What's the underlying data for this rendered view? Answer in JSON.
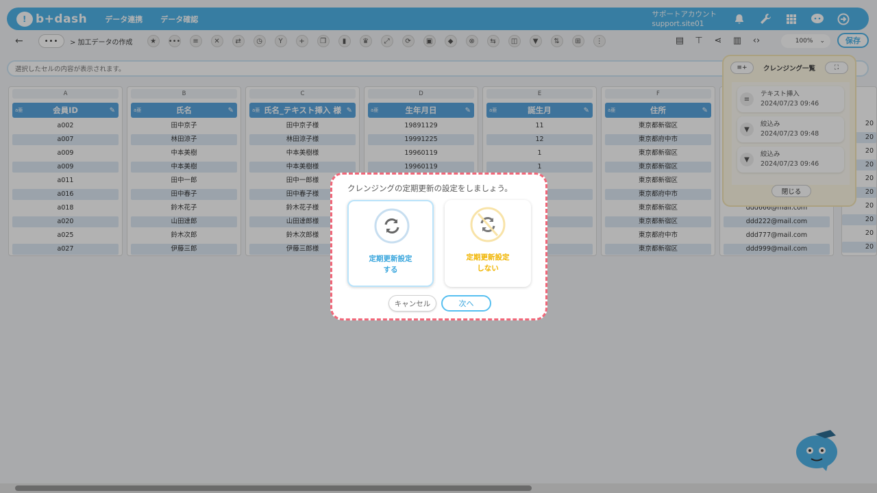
{
  "header": {
    "logo_text": "b+dash",
    "nav": [
      "データ連携",
      "データ確認"
    ],
    "account_label": "サポートアカウント",
    "account_site": "support.site01"
  },
  "toolbar": {
    "more_label": "•••",
    "breadcrumb": "> 加工データの作成",
    "zoom": "100%",
    "save_label": "保存"
  },
  "cellbar": {
    "placeholder": "選択したセルの内容が表示されます。"
  },
  "grid": {
    "columns": [
      {
        "letter": "A",
        "type": "a亜",
        "name": "会員ID",
        "cells": [
          "a002",
          "a007",
          "a009",
          "a009",
          "a011",
          "a016",
          "a018",
          "a020",
          "a025",
          "a027"
        ]
      },
      {
        "letter": "B",
        "type": "a亜",
        "name": "氏名",
        "cells": [
          "田中京子",
          "林田涼子",
          "中本美樹",
          "中本美樹",
          "田中一郎",
          "田中春子",
          "鈴木花子",
          "山田達郎",
          "鈴木次郎",
          "伊藤三郎"
        ]
      },
      {
        "letter": "C",
        "type": "a亜",
        "name": "氏名_テキスト挿入 様",
        "cells": [
          "田中京子様",
          "林田涼子様",
          "中本美樹様",
          "中本美樹様",
          "田中一郎様",
          "田中春子様",
          "鈴木花子様",
          "山田達郎様",
          "鈴木次郎様",
          "伊藤三郎様"
        ]
      },
      {
        "letter": "D",
        "type": "a亜",
        "name": "生年月日",
        "cells": [
          "19891129",
          "19991225",
          "19960119",
          "19960119",
          "",
          "",
          "",
          "",
          "",
          ""
        ]
      },
      {
        "letter": "E",
        "type": "a亜",
        "name": "誕生月",
        "cells": [
          "11",
          "12",
          "1",
          "1",
          "",
          "",
          "",
          "",
          "",
          ""
        ]
      },
      {
        "letter": "F",
        "type": "a亜",
        "name": "住所",
        "cells": [
          "東京都新宿区",
          "東京都府中市",
          "東京都新宿区",
          "東京都新宿区",
          "東京都新宿区",
          "東京都府中市",
          "東京都新宿区",
          "東京都新宿区",
          "東京都府中市",
          "東京都新宿区"
        ]
      },
      {
        "letter": "",
        "type": "",
        "name": "",
        "cells": [
          "",
          "",
          "",
          "",
          "",
          "",
          "ddd666@mail.com",
          "ddd222@mail.com",
          "ddd777@mail.com",
          "ddd999@mail.com"
        ]
      }
    ],
    "clip_cells": [
      "20",
      "20",
      "20",
      "20",
      "20",
      "20",
      "20",
      "20",
      "20",
      "20"
    ]
  },
  "cleansing_panel": {
    "title": "クレンジング一覧",
    "items": [
      {
        "label": "テキスト挿入",
        "time": "2024/07/23 09:46"
      },
      {
        "label": "絞込み",
        "time": "2024/07/23 09:48"
      },
      {
        "label": "絞込み",
        "time": "2024/07/23 09:46"
      }
    ],
    "close_label": "閉じる"
  },
  "modal": {
    "title": "クレンジングの定期更新の設定をしましょう。",
    "option_yes": {
      "line1": "定期更新設定",
      "line2": "する",
      "color": "#3aa6dd"
    },
    "option_no": {
      "line1": "定期更新設定",
      "line2": "しない",
      "color": "#f0b400"
    },
    "cancel_label": "キャンセル",
    "next_label": "次へ"
  }
}
